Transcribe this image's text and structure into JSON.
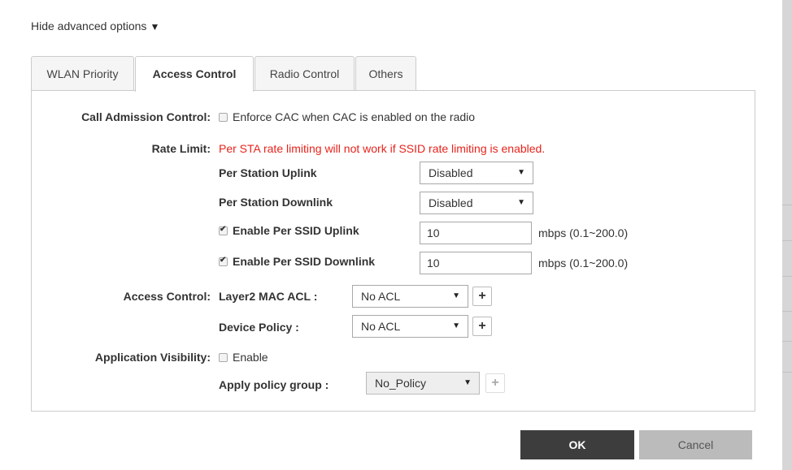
{
  "advanced_toggle": {
    "label": "Hide advanced options",
    "arrow": "▼"
  },
  "tabs": [
    {
      "label": "WLAN Priority"
    },
    {
      "label": "Access Control"
    },
    {
      "label": "Radio Control"
    },
    {
      "label": "Others"
    }
  ],
  "active_tab": "Access Control",
  "call_admission": {
    "label": "Call Admission Control:",
    "checkbox_label": "Enforce CAC when CAC is enabled on the radio",
    "checked": false
  },
  "rate_limit": {
    "label": "Rate Limit:",
    "warning": "Per STA rate limiting will not work if SSID rate limiting is enabled.",
    "per_station_uplink": {
      "label": "Per Station Uplink",
      "value": "Disabled"
    },
    "per_station_downlink": {
      "label": "Per Station Downlink",
      "value": "Disabled"
    },
    "per_ssid_uplink": {
      "label": "Enable Per SSID Uplink",
      "checked": true,
      "value": "10",
      "unit": "mbps (0.1~200.0)"
    },
    "per_ssid_downlink": {
      "label": "Enable Per SSID Downlink",
      "checked": true,
      "value": "10",
      "unit": "mbps (0.1~200.0)"
    }
  },
  "access_control": {
    "label": "Access Control:",
    "layer2": {
      "label": "Layer2 MAC ACL :",
      "value": "No ACL"
    },
    "device_policy": {
      "label": "Device Policy :",
      "value": "No ACL"
    }
  },
  "app_visibility": {
    "label": "Application Visibility:",
    "checkbox_label": "Enable",
    "checked": false,
    "policy_group": {
      "label": "Apply policy group :",
      "value": "No_Policy"
    }
  },
  "buttons": {
    "ok": "OK",
    "cancel": "Cancel"
  },
  "icons": {
    "caret": "▼",
    "plus": "+"
  }
}
